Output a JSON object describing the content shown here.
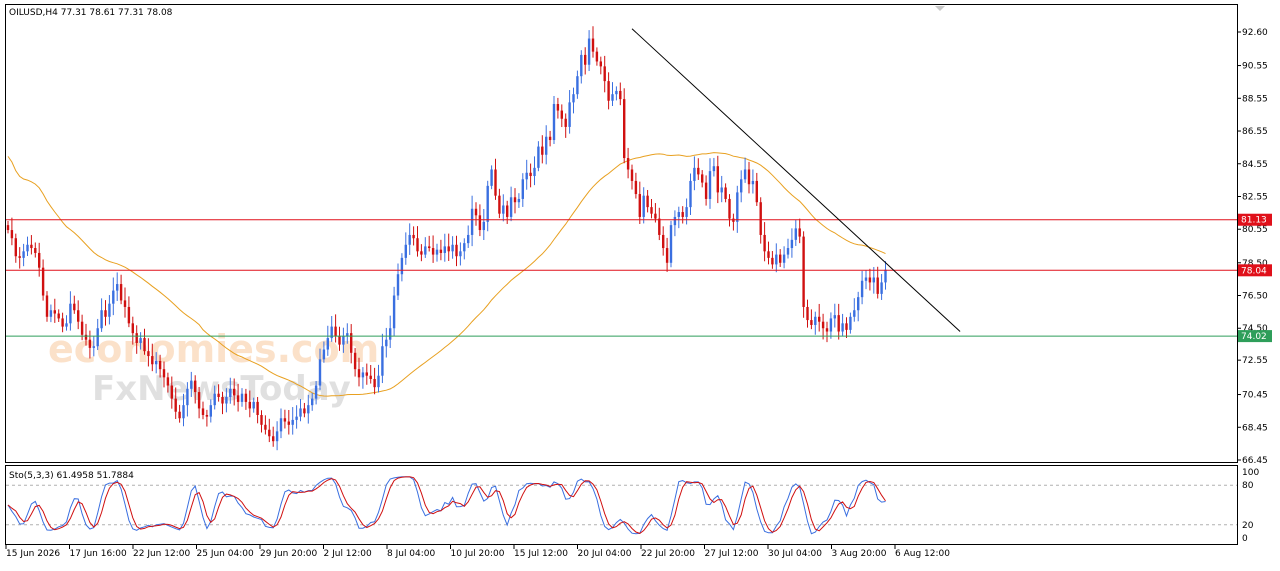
{
  "header": {
    "symbol_line": "OILUSD,H4  77.31 78.61 77.31 78.08",
    "stoch_line": "Sto(5,3,3) 61.4958 51.7884"
  },
  "watermark": {
    "brand_top": "economies.com",
    "brand_bottom": "FxNewsToday"
  },
  "chart_data": {
    "type": "candlestick",
    "symbol": "OILUSD",
    "timeframe": "H4",
    "last_bar": {
      "open": 77.31,
      "high": 78.61,
      "low": 77.31,
      "close": 78.08
    },
    "ylim": [
      66.0,
      93.6
    ],
    "y_ticks": [
      92.6,
      90.55,
      88.55,
      86.55,
      84.55,
      82.55,
      80.55,
      78.5,
      76.5,
      74.5,
      72.55,
      70.45,
      68.45,
      66.45
    ],
    "x_ticks": [
      "15 Jun 2026",
      "17 Jun 16:00",
      "22 Jun 12:00",
      "25 Jun 04:00",
      "29 Jun 20:00",
      "2 Jul 12:00",
      "8 Jul 04:00",
      "10 Jul 20:00",
      "15 Jul 12:00",
      "20 Jul 04:00",
      "22 Jul 20:00",
      "27 Jul 12:00",
      "30 Jul 04:00",
      "3 Aug 20:00",
      "6 Aug 12:00"
    ],
    "horizontal_levels": [
      {
        "value": 81.13,
        "label": "81.13",
        "color": "#e0101a"
      },
      {
        "value": 78.04,
        "label": "78.04",
        "color": "#e0101a"
      },
      {
        "value": 74.02,
        "label": "74.02",
        "color": "#2e9e5a"
      }
    ],
    "trendline": {
      "from": {
        "bar": 160,
        "price": 92.8
      },
      "to": {
        "bar": 239,
        "price": 74.3
      },
      "color": "#000000"
    },
    "moving_average_color": "#e8a020",
    "candle_up_color": "#3a6fe0",
    "candle_down_color": "#d01010",
    "closes": [
      80.5,
      80.0,
      78.9,
      78.8,
      79.2,
      79.6,
      79.4,
      79.1,
      78.2,
      76.5,
      75.2,
      75.6,
      75.4,
      75.1,
      74.6,
      74.8,
      76.0,
      75.6,
      74.9,
      74.1,
      73.8,
      73.3,
      73.4,
      74.5,
      75.6,
      75.2,
      76.0,
      76.8,
      77.2,
      76.2,
      75.8,
      74.8,
      74.2,
      73.6,
      73.9,
      73.1,
      72.8,
      72.3,
      72.5,
      72.0,
      71.5,
      71.0,
      70.2,
      69.4,
      69.0,
      69.8,
      70.8,
      71.3,
      70.6,
      69.6,
      69.2,
      69.1,
      69.8,
      70.5,
      70.3,
      69.9,
      70.3,
      70.8,
      70.4,
      70.0,
      70.5,
      70.0,
      69.6,
      70.0,
      69.2,
      68.6,
      68.3,
      67.9,
      67.6,
      68.2,
      69.0,
      68.8,
      68.6,
      68.9,
      69.1,
      69.6,
      69.3,
      69.8,
      70.2,
      71.0,
      72.6,
      73.2,
      73.9,
      74.6,
      74.0,
      73.5,
      74.0,
      74.2,
      73.0,
      72.0,
      71.5,
      71.8,
      71.6,
      71.4,
      70.9,
      71.6,
      73.4,
      73.8,
      74.5,
      76.5,
      77.8,
      78.8,
      79.6,
      80.2,
      80.0,
      79.2,
      79.0,
      79.5,
      79.4,
      79.0,
      79.3,
      79.1,
      79.5,
      79.2,
      79.6,
      78.9,
      79.2,
      79.7,
      80.2,
      81.8,
      81.4,
      80.5,
      81.0,
      83.2,
      84.2,
      82.6,
      81.5,
      82.0,
      81.3,
      82.5,
      82.2,
      82.4,
      83.6,
      84.0,
      83.8,
      84.3,
      85.6,
      85.1,
      86.2,
      86.0,
      88.2,
      87.8,
      87.3,
      86.8,
      88.3,
      88.8,
      89.9,
      91.2,
      90.6,
      92.2,
      91.4,
      90.8,
      90.5,
      89.6,
      88.4,
      88.8,
      89.0,
      88.5,
      84.9,
      84.2,
      83.5,
      82.7,
      81.3,
      82.6,
      81.9,
      81.5,
      81.2,
      80.2,
      79.4,
      78.5,
      80.8,
      81.3,
      81.6,
      81.3,
      81.9,
      83.5,
      84.3,
      83.9,
      83.4,
      82.4,
      84.1,
      84.4,
      82.8,
      83.1,
      82.4,
      81.2,
      81.0,
      82.8,
      83.6,
      84.2,
      83.3,
      83.5,
      82.2,
      80.2,
      79.2,
      78.8,
      78.4,
      79.0,
      78.5,
      79.0,
      79.4,
      79.9,
      80.6,
      80.1,
      75.8,
      75.0,
      74.7,
      75.2,
      74.9,
      74.5,
      74.3,
      75.1,
      75.3,
      74.3,
      74.8,
      74.4,
      75.2,
      75.6,
      76.4,
      77.4,
      77.6,
      77.3,
      77.6,
      76.6,
      77.3,
      78.08
    ],
    "stochastic": {
      "name": "Sto(5,3,3)",
      "k_value": 61.4958,
      "d_value": 51.7884,
      "ylim": [
        0,
        100
      ],
      "y_ticks": [
        100,
        80,
        20,
        0
      ],
      "levels": [
        80,
        20
      ],
      "k_color": "#3a6fe0",
      "d_color": "#d01010"
    }
  }
}
